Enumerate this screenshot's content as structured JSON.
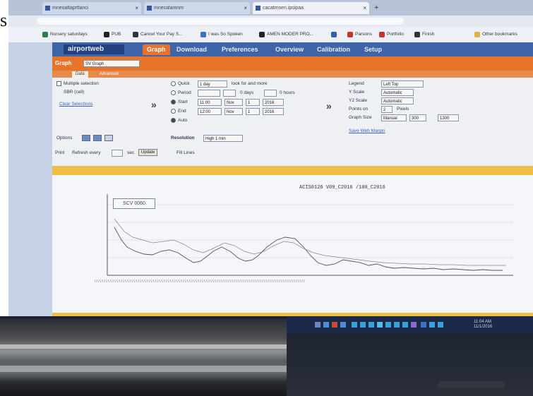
{
  "browser": {
    "tabs": [
      {
        "label": "mneoaltaprtlanci"
      },
      {
        "label": "mnecalamnm"
      },
      {
        "label": "cacatmsen.ipsipaa",
        "active": true
      }
    ],
    "bookmarks": [
      {
        "label": "Nursery saturdays",
        "color": "#2f7d4f"
      },
      {
        "label": "PUB",
        "color": "#222222"
      },
      {
        "label": "Cancel Your Pay S...",
        "color": "#333333"
      },
      {
        "label": "I was So Spoken",
        "color": "#3a74c9"
      },
      {
        "label": "AMEN MODER PRO...",
        "color": "#222222"
      },
      {
        "label": "",
        "color": "#2e5fb0"
      },
      {
        "label": "Parsons",
        "color": "#c8342c"
      },
      {
        "label": "Portfolio",
        "color": "#c8342c"
      },
      {
        "label": "Finish",
        "color": "#333333"
      },
      {
        "label": "Other bookmarks",
        "color": "#e0b24a"
      }
    ]
  },
  "app": {
    "logo": "airportweb",
    "nav": [
      "Graph",
      "Download",
      "Preferences",
      "Overview",
      "Calibration",
      "Setup"
    ],
    "graph_selector_label": "Graph",
    "graph_selector_value": "SV Graph",
    "subtabs": [
      "Data",
      "Advanced"
    ],
    "options": {
      "multiple_selection": "Multiple selection",
      "item": "SBR (cell)",
      "clear_link": "Clear Selections"
    },
    "range": {
      "quick_label": "Quick",
      "quick_value": "1 day",
      "quick_suffix": "look for and more",
      "period_label": "Period",
      "period_days": "0 days",
      "period_hours": "0 hours",
      "start_label": "Start",
      "start_value": "11:00",
      "start_month": "Nov",
      "start_day": "1",
      "start_year": "2016",
      "end_label": "End",
      "end_value": "12:00",
      "end_month": "Nov",
      "end_day": "1",
      "end_year": "2016",
      "auto_label": "Auto"
    },
    "display": {
      "legend_label": "Legend",
      "legend_value": "Left Top",
      "yscale_label": "Y Scale",
      "yscale_value": "Automatic",
      "y2scale_label": "Y2 Scale",
      "y2scale_value": "Automatic",
      "points_label": "Points on",
      "points_value": "2",
      "points_suffix": "Pixels",
      "size_label": "Graph Size",
      "size_mode": "Manual",
      "size_w": "300",
      "size_h": "1300",
      "save_link": "Save Web Margin"
    },
    "options_row": {
      "options_label": "Options",
      "resolution_label": "Resolution",
      "resolution_value": "High 1 min"
    },
    "action_row": {
      "print_label": "Print",
      "refresh_label": "Refresh every",
      "sec_label": "sec",
      "update_button": "Update",
      "status": "Fill Lines"
    },
    "graph": {
      "title": "ACIS0126 V09_C2016 /100_C2016",
      "tooltip": "SCV 0060"
    }
  },
  "taskbar": {
    "time": "11:04 AM",
    "date": "11/1/2016"
  }
}
